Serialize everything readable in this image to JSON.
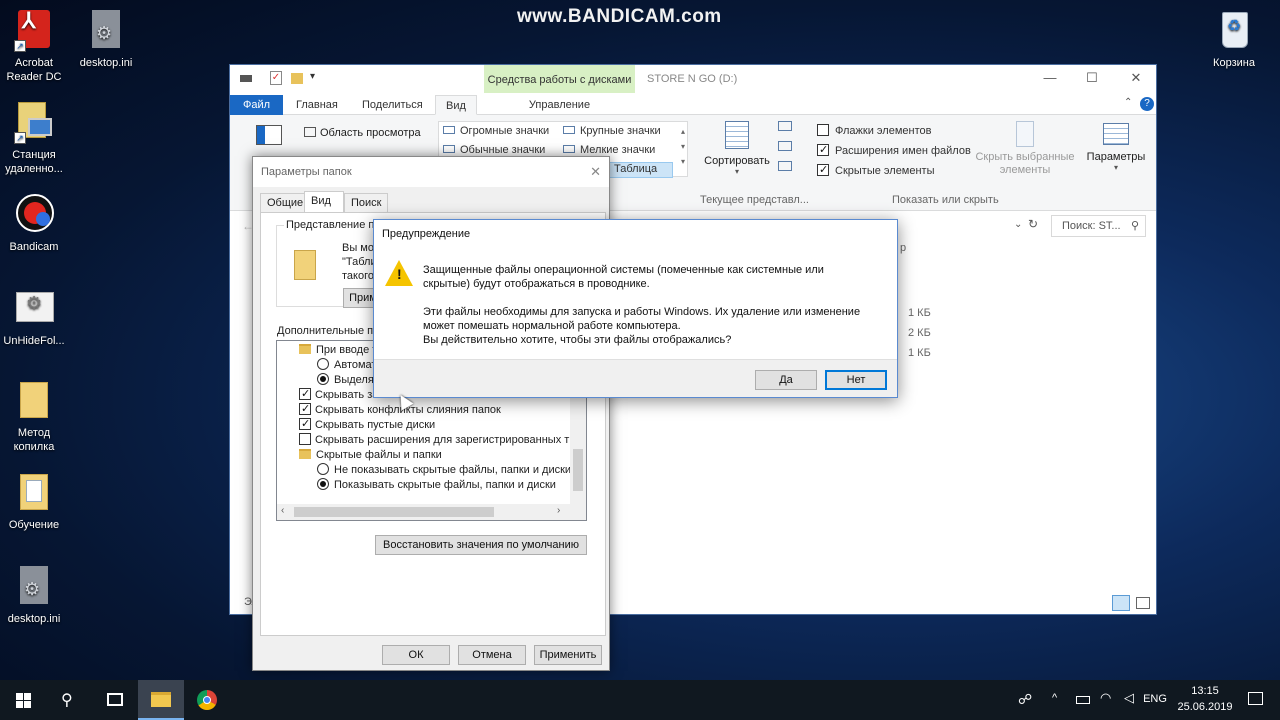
{
  "watermark": "www.BANDICAM.com",
  "desktop": {
    "icons": [
      {
        "label": "Acrobat Reader DC"
      },
      {
        "label": "desktop.ini"
      },
      {
        "label": "Станция удаленно..."
      },
      {
        "label": "Bandicam"
      },
      {
        "label": "UnHideFol..."
      },
      {
        "label": "Метод копилка"
      },
      {
        "label": "Обучение"
      },
      {
        "label": "desktop.ini"
      },
      {
        "label": "Корзина"
      }
    ]
  },
  "explorer": {
    "context_tab_title": "Средства работы с дисками",
    "window_title": "STORE N GO (D:)",
    "tabs": {
      "file": "Файл",
      "home": "Главная",
      "share": "Поделиться",
      "view": "Вид",
      "manage": "Управление"
    },
    "ribbon": {
      "preview_pane": "Область просмотра",
      "layout": {
        "huge_icons": "Огромные значки",
        "large_icons": "Крупные значки",
        "normal_icons": "Обычные значки",
        "small_icons": "Мелкие значки",
        "table": "Таблица"
      },
      "sort_label": "Сортировать",
      "current_view_group": "Текущее представл...",
      "item_checkboxes": "Флажки элементов",
      "file_extensions": "Расширения имен файлов",
      "hidden_items": "Скрытые элементы",
      "hide_selected": "Скрыть выбранные элементы",
      "show_hide_group": "Показать или скрыть",
      "options": "Параметры"
    },
    "search_placeholder": "Поиск: ST...",
    "column_header_partial": "р",
    "file_sizes": [
      "1 КБ",
      "2 КБ",
      "1 КБ"
    ],
    "status_partial": "Эл"
  },
  "folder_options": {
    "title": "Параметры папок",
    "tabs": [
      "Общие",
      "Вид",
      "Поиск"
    ],
    "folder_views_label": "Представление па",
    "folder_views_text": [
      "Вы мо",
      "\"Табли",
      "такого"
    ],
    "apply_button_partial": "Прим",
    "advanced_label": "Дополнительные па",
    "tree": [
      {
        "kind": "folder",
        "text": "При вводе т"
      },
      {
        "kind": "radio",
        "checked": false,
        "text": "Автомат"
      },
      {
        "kind": "radio",
        "checked": true,
        "text": "Выделя"
      },
      {
        "kind": "check",
        "checked": true,
        "text": "Скрывать за"
      },
      {
        "kind": "check",
        "checked": true,
        "text": "Скрывать конфликты слияния папок"
      },
      {
        "kind": "check",
        "checked": true,
        "text": "Скрывать пустые диски"
      },
      {
        "kind": "check",
        "checked": false,
        "text": "Скрывать расширения для зарегистрированных типо"
      },
      {
        "kind": "folder",
        "text": "Скрытые файлы и папки"
      },
      {
        "kind": "radio",
        "checked": false,
        "text": "Не показывать скрытые файлы, папки и диски"
      },
      {
        "kind": "radio",
        "checked": true,
        "text": "Показывать скрытые файлы, папки и диски"
      }
    ],
    "restore_defaults": "Восстановить значения по умолчанию",
    "ok": "ОК",
    "cancel": "Отмена",
    "apply": "Применить"
  },
  "warning": {
    "title": "Предупреждение",
    "line1": "Защищенные файлы операционной системы (помеченные как системные или",
    "line2": "скрытые) будут отображаться в проводнике.",
    "line3": "Эти файлы необходимы для запуска и работы Windows. Их удаление или изменение",
    "line4": "может помешать нормальной работе компьютера.",
    "line5": "Вы действительно хотите, чтобы  эти файлы отображались?",
    "yes": "Да",
    "no": "Нет"
  },
  "taskbar": {
    "lang": "ENG",
    "time": "13:15",
    "date": "25.06.2019"
  },
  "colors": {
    "accent": "#0078d7",
    "file_tab": "#1a68c4",
    "context_tab": "#d8f0c4"
  }
}
